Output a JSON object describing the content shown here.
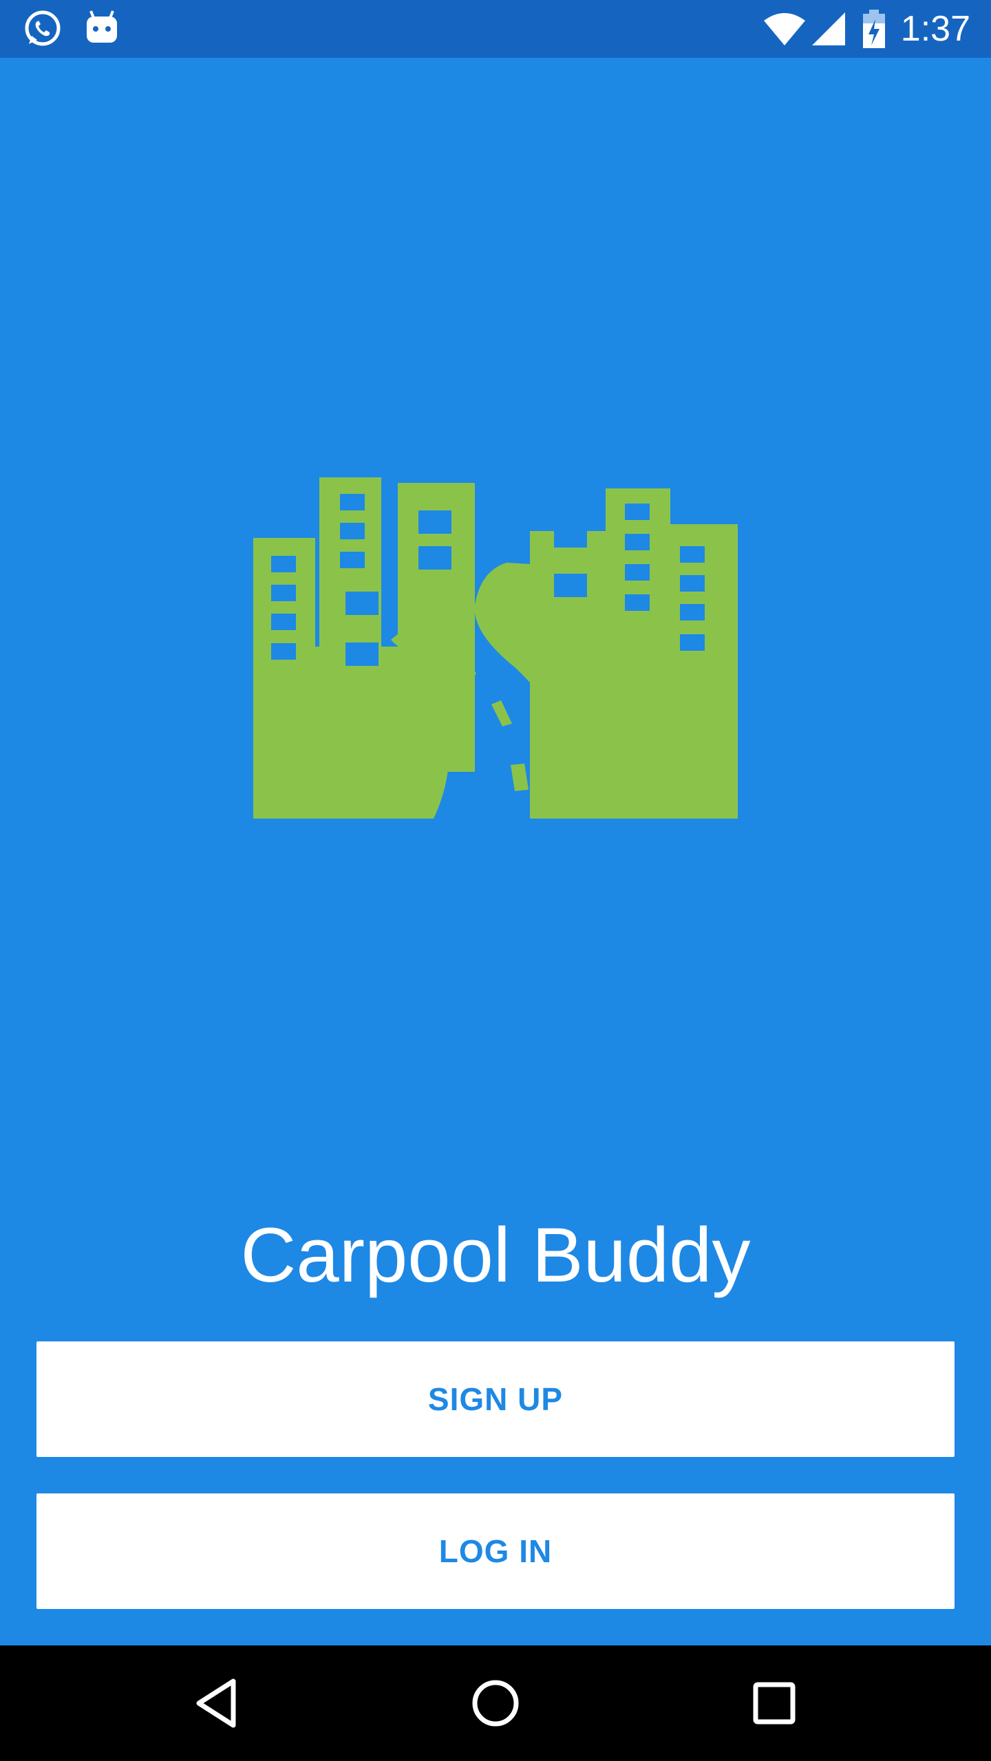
{
  "status_bar": {
    "time": "1:37",
    "icons": [
      "whatsapp-icon",
      "android-icon",
      "wifi-icon",
      "cell-signal-icon",
      "battery-charging-icon"
    ]
  },
  "app": {
    "title": "Carpool Buddy",
    "logo_icon": "city-road-logo-icon"
  },
  "buttons": {
    "signup_label": "SIGN UP",
    "login_label": "LOG IN"
  },
  "nav_bar": {
    "icons": [
      "back-icon",
      "home-icon",
      "recents-icon"
    ]
  },
  "colors": {
    "primary": "#1e88e5",
    "status_bar": "#1565c0",
    "logo_green": "#8bc34a",
    "button_bg": "#ffffff",
    "nav_bar": "#000000"
  }
}
